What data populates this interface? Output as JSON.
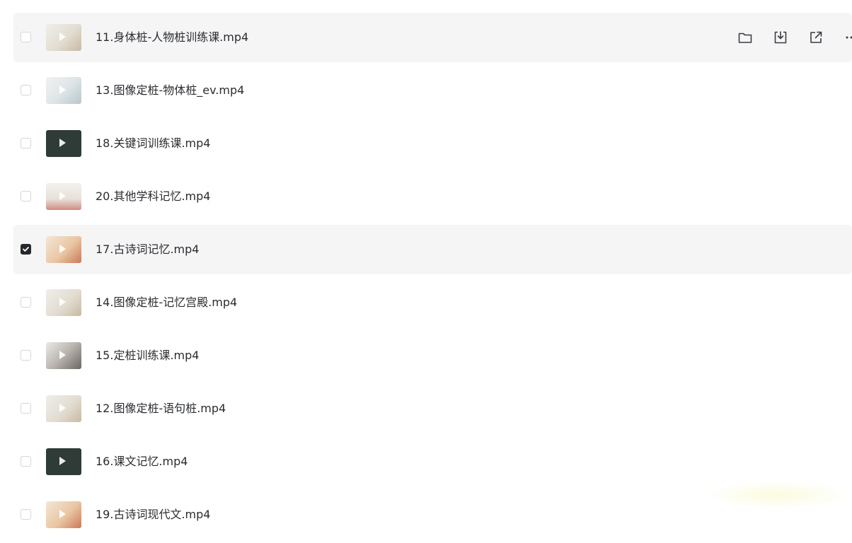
{
  "files": [
    {
      "name": "11.身体桩-人物桩训练课.mp4",
      "checked": false,
      "thumb": "slide-light"
    },
    {
      "name": "13.图像定桩-物体桩_ev.mp4",
      "checked": false,
      "thumb": "slide-doodle"
    },
    {
      "name": "18.关键词训练课.mp4",
      "checked": false,
      "thumb": "video-dark"
    },
    {
      "name": "20.其他学科记忆.mp4",
      "checked": false,
      "thumb": "slide-table"
    },
    {
      "name": "17.古诗词记忆.mp4",
      "checked": true,
      "thumb": "slide-warm"
    },
    {
      "name": "14.图像定桩-记忆宫殿.mp4",
      "checked": false,
      "thumb": "slide-light"
    },
    {
      "name": "15.定桩训练课.mp4",
      "checked": false,
      "thumb": "slide-photo"
    },
    {
      "name": "12.图像定桩-语句桩.mp4",
      "checked": false,
      "thumb": "slide-light"
    },
    {
      "name": "16.课文记忆.mp4",
      "checked": false,
      "thumb": "video-dark"
    },
    {
      "name": "19.古诗词现代文.mp4",
      "checked": false,
      "thumb": "slide-warm"
    }
  ],
  "row_actions": [
    {
      "icon": "folder-icon",
      "label": "open-folder"
    },
    {
      "icon": "download-icon",
      "label": "download"
    },
    {
      "icon": "share-icon",
      "label": "share"
    },
    {
      "icon": "more-icon",
      "label": "more"
    }
  ],
  "colors": {
    "row_highlight": "#f5f5f6",
    "text": "#2a2c30",
    "checkbox_checked": "#25272c",
    "icon": "#3b3d42"
  }
}
